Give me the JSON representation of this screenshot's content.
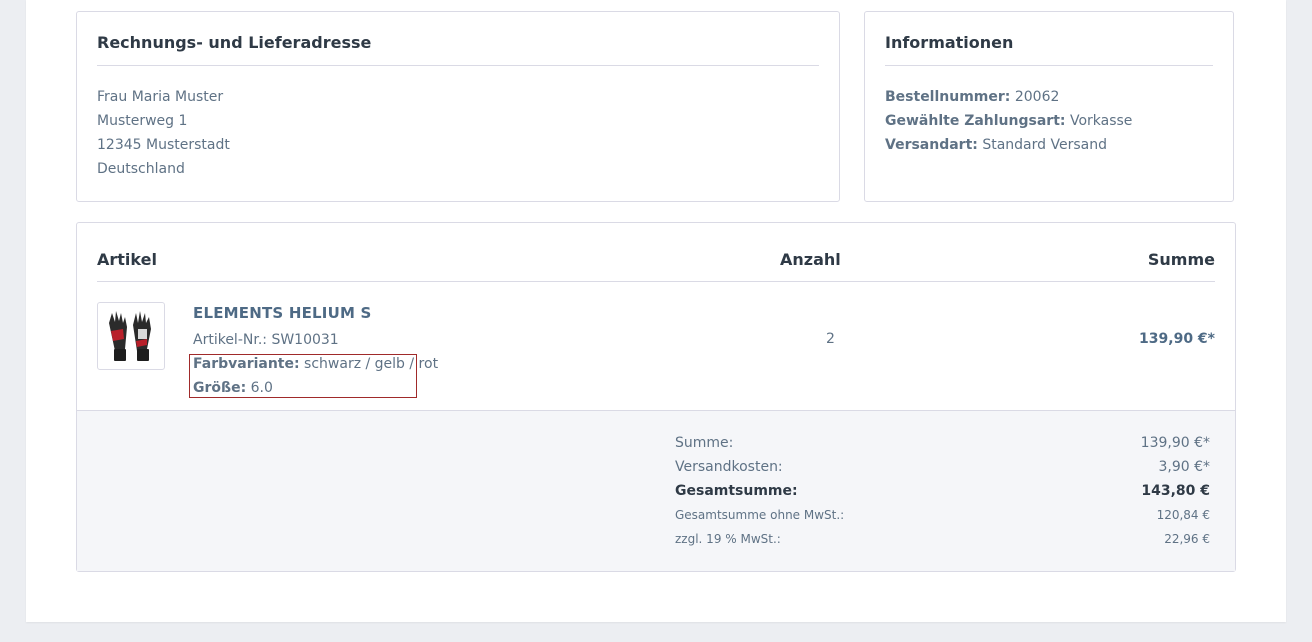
{
  "billing": {
    "title": "Rechnungs- und Lieferadresse",
    "lines": [
      "Frau Maria Muster",
      "Musterweg 1",
      "12345 Musterstadt",
      "Deutschland"
    ]
  },
  "info": {
    "title": "Informationen",
    "order_number_label": "Bestellnummer:",
    "order_number": "20062",
    "payment_label": "Gewählte Zahlungsart:",
    "payment": "Vorkasse",
    "shipping_label": "Versandart:",
    "shipping": "Standard Versand"
  },
  "table": {
    "headers": {
      "item": "Artikel",
      "qty": "Anzahl",
      "sum": "Summe"
    },
    "item": {
      "name": "ELEMENTS HELIUM S",
      "sku_label": "Artikel-Nr.:",
      "sku": "SW10031",
      "color_label": "Farbvariante:",
      "color": "schwarz / gelb / rot",
      "size_label": "Größe:",
      "size": "6.0",
      "qty": "2",
      "sum": "139,90 €*",
      "image_icon": "glove-product-icon"
    }
  },
  "totals": [
    {
      "label": "Summe:",
      "value": "139,90 €*"
    },
    {
      "label": "Versandkosten:",
      "value": "3,90 €*"
    },
    {
      "label": "Gesamtsumme:",
      "value": "143,80 €"
    },
    {
      "label": "Gesamtsumme ohne MwSt.:",
      "value": "120,84 €"
    },
    {
      "label": "zzgl. 19 % MwSt.:",
      "value": "22,96 €"
    }
  ],
  "colors": {
    "highlight_border": "#a02a2a",
    "heading": "#2f3a46",
    "text": "#5f7285"
  }
}
